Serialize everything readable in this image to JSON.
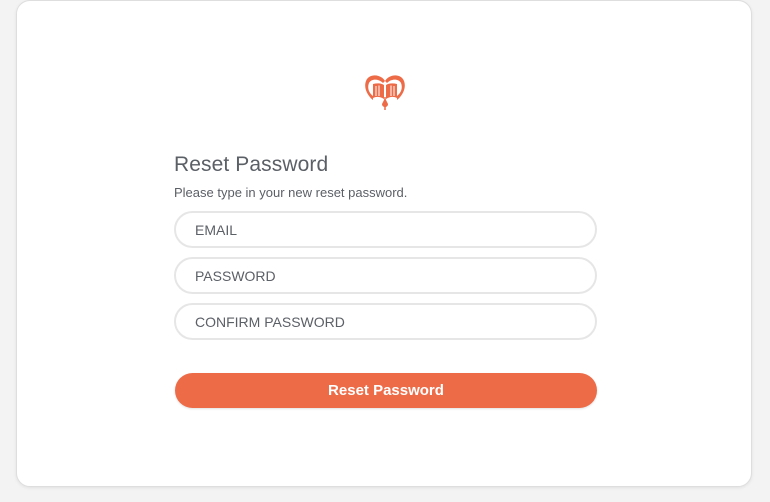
{
  "brand": {
    "logo_icon": "heart-book-logo-icon",
    "accent_color": "#ee6b47"
  },
  "form": {
    "title": "Reset Password",
    "subtitle": "Please type in your new reset password.",
    "email_placeholder": "EMAIL",
    "password_placeholder": "PASSWORD",
    "confirm_placeholder": "CONFIRM PASSWORD",
    "submit_label": "Reset Password"
  }
}
